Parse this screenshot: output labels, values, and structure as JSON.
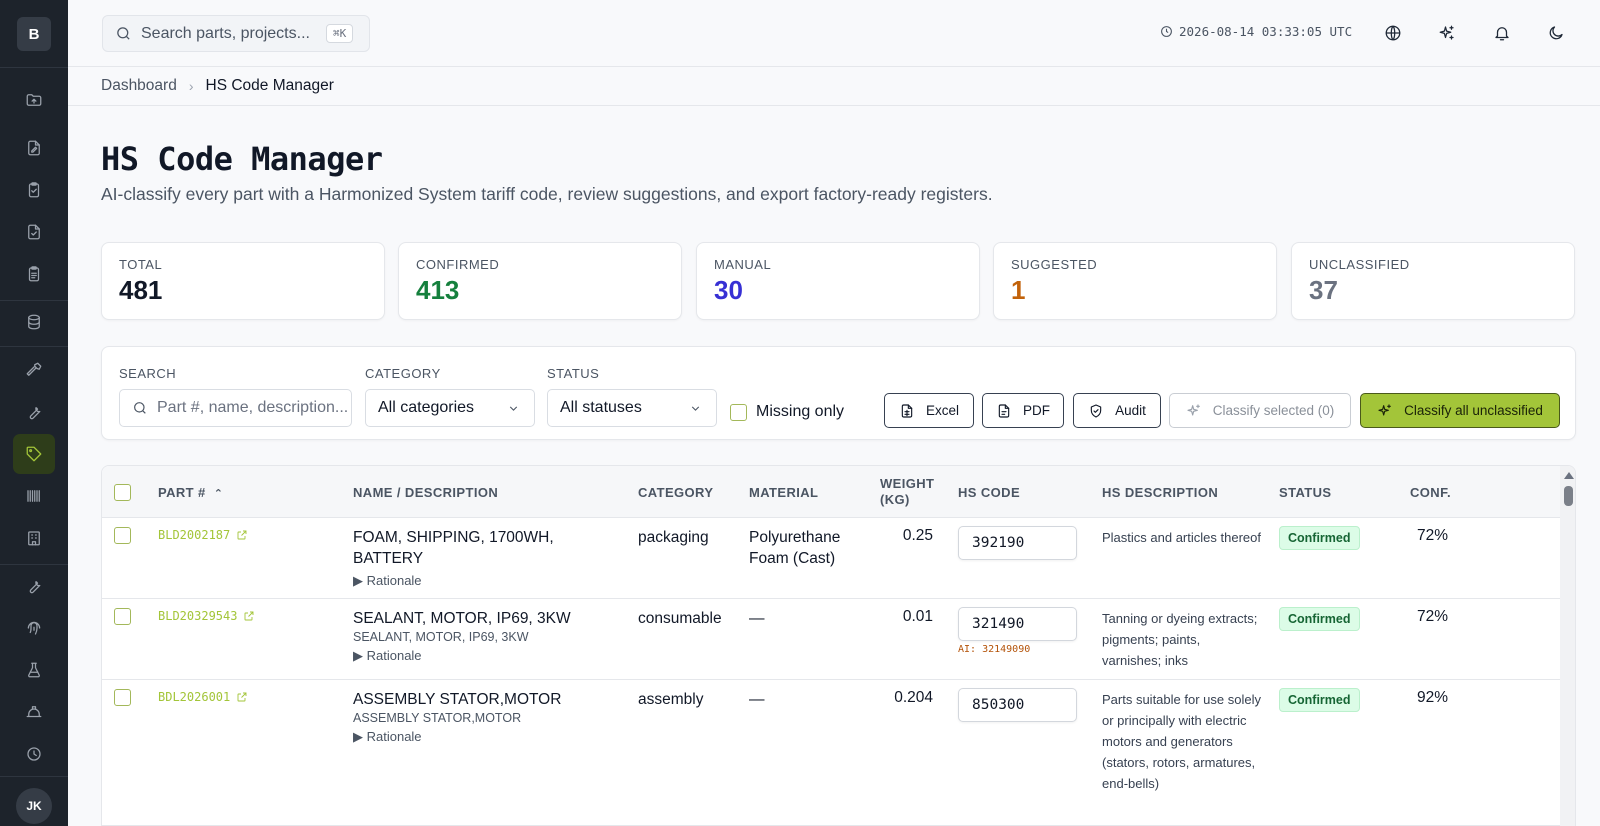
{
  "app": {
    "logo_letter": "B",
    "user_initials": "JK"
  },
  "topbar": {
    "search_placeholder": "Search parts, projects...",
    "shortcut": "⌘K",
    "timestamp": "2026-08-14 03:33:05 UTC"
  },
  "breadcrumb": {
    "parent": "Dashboard",
    "current": "HS Code Manager"
  },
  "page": {
    "title": "HS Code Manager",
    "subtitle": "AI-classify every part with a Harmonized System tariff code, review suggestions, and export factory-ready registers."
  },
  "stats": [
    {
      "label": "TOTAL",
      "value": "481",
      "color": "#111827"
    },
    {
      "label": "CONFIRMED",
      "value": "413",
      "color": "#15803d"
    },
    {
      "label": "MANUAL",
      "value": "30",
      "color": "#3730d4"
    },
    {
      "label": "SUGGESTED",
      "value": "1",
      "color": "#c2620a"
    },
    {
      "label": "UNCLASSIFIED",
      "value": "37",
      "color": "#6b7280"
    }
  ],
  "filters": {
    "search_label": "SEARCH",
    "search_placeholder": "Part #, name, description...",
    "category_label": "CATEGORY",
    "category_value": "All categories",
    "status_label": "STATUS",
    "status_value": "All statuses",
    "missing_only": "Missing only",
    "btn_excel": "Excel",
    "btn_pdf": "PDF",
    "btn_audit": "Audit",
    "btn_classify_selected": "Classify selected (0)",
    "btn_classify_all": "Classify all unclassified"
  },
  "table": {
    "headers": {
      "part": "PART #",
      "name": "NAME / DESCRIPTION",
      "category": "CATEGORY",
      "material": "MATERIAL",
      "weight_1": "WEIGHT",
      "weight_2": "(KG)",
      "hs_code": "HS CODE",
      "hs_desc": "HS DESCRIPTION",
      "status": "STATUS",
      "conf": "CONF."
    },
    "rows": [
      {
        "part": "BLD2002187",
        "name": "FOAM, SHIPPING, 1700WH, BATTERY",
        "sub": "",
        "rationale": "▶ Rationale",
        "category": "packaging",
        "material": "Polyurethane Foam (Cast)",
        "weight": "0.25",
        "hs_code": "392190",
        "ai": "",
        "hs_desc": "Plastics and articles thereof",
        "status": "Confirmed",
        "conf": "72%"
      },
      {
        "part": "BLD20329543",
        "name": "SEALANT, MOTOR, IP69, 3KW",
        "sub": "SEALANT, MOTOR, IP69, 3KW",
        "rationale": "▶ Rationale",
        "category": "consumable",
        "material": "—",
        "weight": "0.01",
        "hs_code": "321490",
        "ai": "AI: 32149090",
        "hs_desc": "Tanning or dyeing extracts; pigments; paints, varnishes; inks",
        "status": "Confirmed",
        "conf": "72%"
      },
      {
        "part": "BDL2026001",
        "name": "ASSEMBLY STATOR,MOTOR",
        "sub": "ASSEMBLY STATOR,MOTOR",
        "rationale": "▶ Rationale",
        "category": "assembly",
        "material": "—",
        "weight": "0.204",
        "hs_code": "850300",
        "ai": "",
        "hs_desc": "Parts suitable for use solely or principally with electric motors and generators (stators, rotors, armatures, end-bells)",
        "status": "Confirmed",
        "conf": "92%"
      }
    ]
  },
  "icons": {
    "sidebar": [
      "upload-folder-icon",
      "edit-document-icon",
      "clipboard-check-icon",
      "file-check-icon",
      "clipboard-list-icon",
      "database-icon",
      "hammer-icon",
      "wrench-icon",
      "tag-icon",
      "barcode-icon",
      "factory-icon",
      "wrench-icon",
      "fingerprint-icon",
      "flask-icon",
      "hard-hat-icon",
      "clock-icon"
    ],
    "topbar": [
      "globe-icon",
      "sparkles-icon",
      "bell-icon",
      "moon-icon"
    ]
  },
  "colors": {
    "accent": "#a3c539",
    "sidebar_bg": "#1d232b",
    "badge_bg": "#dcfce7",
    "badge_text": "#166534"
  }
}
